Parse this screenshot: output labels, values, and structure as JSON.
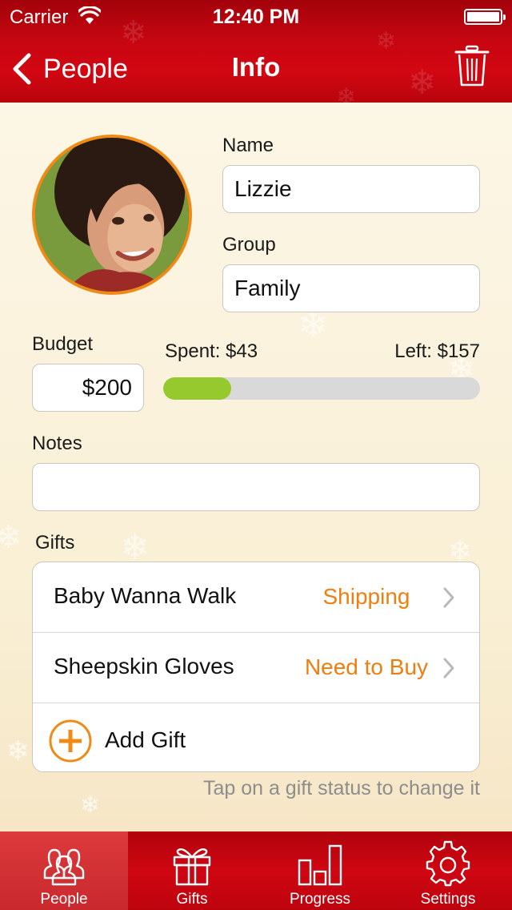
{
  "status_bar": {
    "carrier": "Carrier",
    "time": "12:40 PM"
  },
  "nav": {
    "back_label": "People",
    "title": "Info",
    "trash_icon": "trash-icon"
  },
  "person": {
    "name_label": "Name",
    "name_value": "Lizzie",
    "group_label": "Group",
    "group_value": "Family",
    "budget_label": "Budget",
    "budget_value": "$200",
    "spent_text": "Spent: $43",
    "left_text": "Left: $157",
    "spent_fraction": 0.215,
    "notes_label": "Notes",
    "notes_value": ""
  },
  "gifts": {
    "label": "Gifts",
    "items": [
      {
        "name": "Baby Wanna Walk",
        "status": "Shipping"
      },
      {
        "name": "Sheepskin Gloves",
        "status": "Need to Buy"
      }
    ],
    "add_label": "Add Gift",
    "hint": "Tap on a gift status to change it"
  },
  "tabbar": {
    "tabs": [
      {
        "label": "People",
        "icon": "people-icon",
        "active": true
      },
      {
        "label": "Gifts",
        "icon": "gift-icon",
        "active": false
      },
      {
        "label": "Progress",
        "icon": "bar-chart-icon",
        "active": false
      },
      {
        "label": "Settings",
        "icon": "gear-icon",
        "active": false
      }
    ]
  },
  "colors": {
    "accent_red": "#c70611",
    "accent_orange": "#f08a16",
    "progress_green": "#96c92e"
  }
}
